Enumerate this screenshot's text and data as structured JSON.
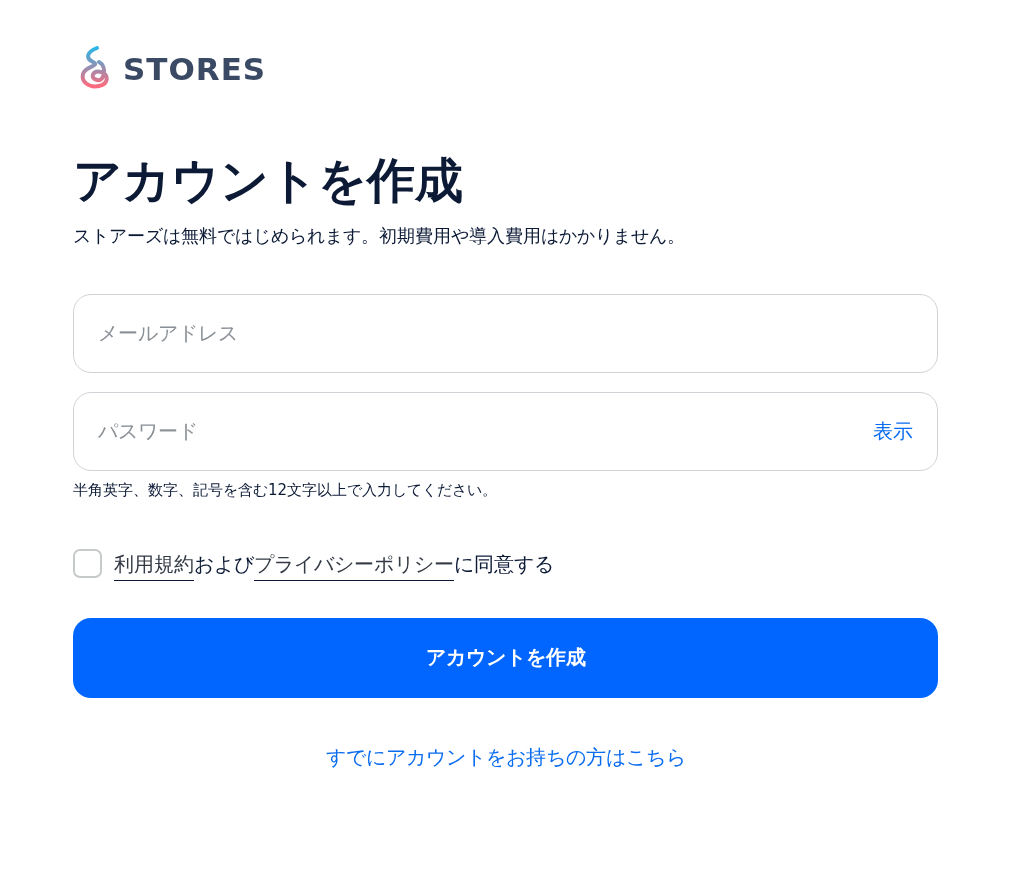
{
  "logo": {
    "text": "STORES"
  },
  "title": "アカウントを作成",
  "subtitle": "ストアーズは無料ではじめられます。初期費用や導入費用はかかりません。",
  "email_field": {
    "placeholder": "メールアドレス"
  },
  "password_field": {
    "placeholder": "パスワード",
    "toggle": "表示"
  },
  "password_hint": "半角英字、数字、記号を含む12文字以上で入力してください。",
  "agreement": {
    "checked": false,
    "parts": [
      {
        "kind": "link",
        "text": "利用規約"
      },
      {
        "kind": "text",
        "text": "および"
      },
      {
        "kind": "link",
        "text": "プライバシーポリシー"
      },
      {
        "kind": "text",
        "text": "に同意する"
      }
    ]
  },
  "submit_button": "アカウントを作成",
  "login_link": "すでにアカウントをお持ちの方はこちら"
}
